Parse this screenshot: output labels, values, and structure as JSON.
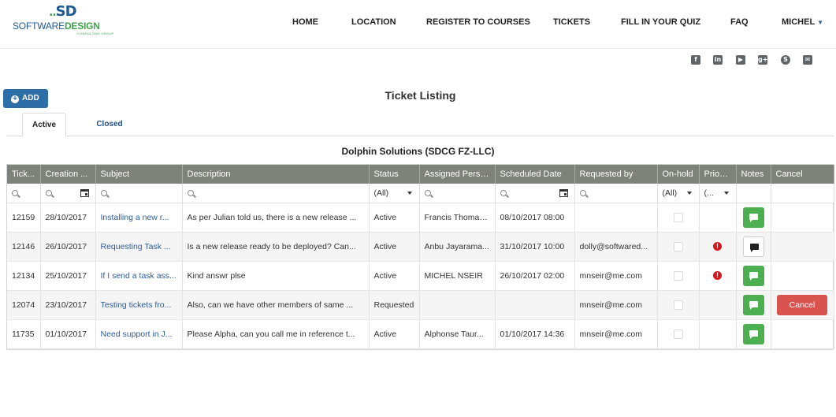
{
  "brand": {
    "mark": "SD",
    "name_part1": "SOFTWARE",
    "name_part2": "DESIGN",
    "tagline": "CONSULTING GROUP"
  },
  "nav": {
    "home": "HOME",
    "location": "LOCATION",
    "register": "REGISTER TO COURSES",
    "tickets": "TICKETS",
    "quiz": "FILL IN YOUR QUIZ",
    "faq": "FAQ",
    "user": "MICHEL"
  },
  "social": {
    "facebook": "f",
    "linkedin": "in",
    "youtube": "▶",
    "googleplus": "g+",
    "skype": "S",
    "email": "✉"
  },
  "toolbar": {
    "add_label": "ADD"
  },
  "page": {
    "title": "Ticket Listing",
    "company": "Dolphin Solutions (SDCG FZ-LLC)"
  },
  "tabs": {
    "active": "Active",
    "closed": "Closed"
  },
  "grid": {
    "columns": [
      "Tick...",
      "Creation ...",
      "Subject",
      "Description",
      "Status",
      "Assigned Person",
      "Scheduled Date",
      "Requested by",
      "On-hold",
      "Priority",
      "Notes",
      "Cancel"
    ],
    "filters": {
      "status": "(All)",
      "onhold": "(All)",
      "priority": "(..."
    },
    "rows": [
      {
        "id": "12159",
        "created": "28/10/2017",
        "subject": "Installing a new r...",
        "description": "As per Julian told us, there is a new release ...",
        "status": "Active",
        "assigned": "Francis Thomas...",
        "scheduled": "08/10/2017 08:00",
        "requested_by": "",
        "priority_flag": "",
        "note_style": "green",
        "cancel": ""
      },
      {
        "id": "12146",
        "created": "26/10/2017",
        "subject": "Requesting Task ...",
        "description": "Is a new release ready to be deployed? Can...",
        "status": "Active",
        "assigned": "Anbu Jayarama...",
        "scheduled": "31/10/2017 10:00",
        "requested_by": "dolly@softwared...",
        "priority_flag": "!",
        "note_style": "plain",
        "cancel": ""
      },
      {
        "id": "12134",
        "created": "25/10/2017",
        "subject": "If I send a task ass...",
        "description": "Kind answr plse",
        "status": "Active",
        "assigned": "MICHEL NSEIR",
        "scheduled": "26/10/2017 02:00",
        "requested_by": "mnseir@me.com",
        "priority_flag": "!",
        "note_style": "green",
        "cancel": ""
      },
      {
        "id": "12074",
        "created": "23/10/2017",
        "subject": "Testing tickets fro...",
        "description": "Also, can we have other members of same ...",
        "status": "Requested",
        "assigned": "",
        "scheduled": "",
        "requested_by": "mnseir@me.com",
        "priority_flag": "",
        "note_style": "green",
        "cancel": "Cancel"
      },
      {
        "id": "11735",
        "created": "01/10/2017",
        "subject": "Need support in J...",
        "description": "Please Alpha, can you call me in reference t...",
        "status": "Active",
        "assigned": "Alphonse Taur...",
        "scheduled": "01/10/2017 14:36",
        "requested_by": "mnseir@me.com",
        "priority_flag": "",
        "note_style": "green",
        "cancel": ""
      }
    ]
  },
  "colors": {
    "header_bg": "#7e8279",
    "accent_blue": "#2d6ea8",
    "note_green": "#4caf50",
    "cancel_red": "#d9534f",
    "priority_red": "#d9141c"
  }
}
